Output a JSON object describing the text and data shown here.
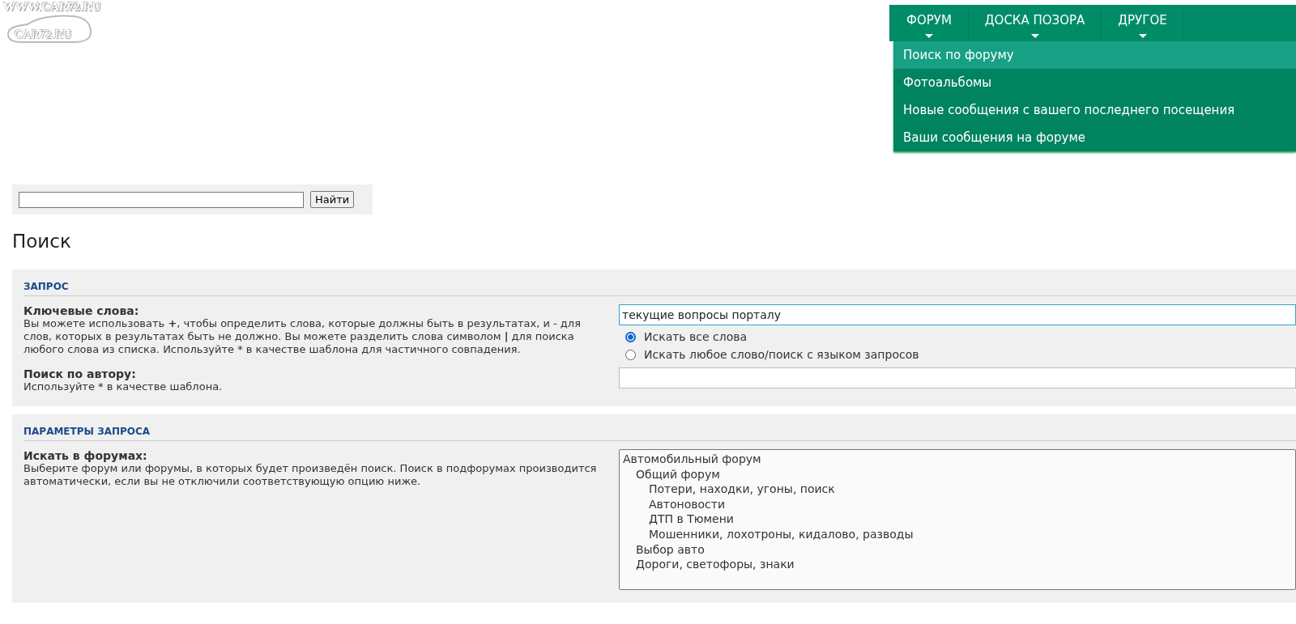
{
  "logo": {
    "line_1": "WWW.CAR72.RU",
    "line_2": "CAR72.RU"
  },
  "nav": {
    "items": [
      {
        "label": "ФОРУМ"
      },
      {
        "label": "ДОСКА ПОЗОРА"
      },
      {
        "label": "ДРУГОЕ"
      }
    ]
  },
  "dropdown": {
    "items": [
      {
        "label": "Поиск по форуму",
        "selected": true
      },
      {
        "label": "Фотоальбомы",
        "selected": false
      },
      {
        "label": "Новые сообщения с вашего последнего посещения",
        "selected": false
      },
      {
        "label": "Ваши сообщения на форуме",
        "selected": false
      }
    ]
  },
  "quick_search": {
    "button": "Найти"
  },
  "heading": "Поиск",
  "sections": [
    {
      "title": "ЗАПРОС",
      "fields": [
        {
          "kind": "text",
          "label": "Ключевые слова:",
          "description": "Вы можете использовать **+**, чтобы определить слова, которые должны быть в результатах, и - для слов, которых в результатах быть не должно. Вы можете разделить слова символом **|** для поиска любого слова из списка. Используйте * в качестве шаблона для частичного совпадения.",
          "value": "текущие вопросы порталу",
          "options": [
            {
              "label": "Искать все слова",
              "selected": true
            },
            {
              "label": "Искать любое слово/поиск с языком запросов",
              "selected": false
            }
          ]
        },
        {
          "kind": "text",
          "label": "Поиск по автору:",
          "description": "Используйте * в качестве шаблона."
        }
      ]
    },
    {
      "title": "ПАРАМЕТРЫ ЗАПРОСА",
      "fields": [
        {
          "kind": "listbox",
          "label": "Искать в форумах:",
          "description": "Выберите форум или форумы, в которых будет произведён поиск. Поиск в подфорумах производится автоматически, если вы не отключили соответствующую опцию ниже.",
          "forums": [
            {
              "label": "Автомобильный форум",
              "children": [
                {
                  "label": "Общий форум",
                  "children": [
                    {
                      "label": "Потери, находки, угоны, поиск"
                    },
                    {
                      "label": "Автоновости"
                    },
                    {
                      "label": "ДТП в Тюмени"
                    },
                    {
                      "label": "Мошенники, лохотроны, кидалово, разводы"
                    }
                  ]
                },
                {
                  "label": "Выбор авто"
                },
                {
                  "label": "Дороги, светофоры, знаки"
                }
              ]
            }
          ]
        }
      ]
    }
  ]
}
